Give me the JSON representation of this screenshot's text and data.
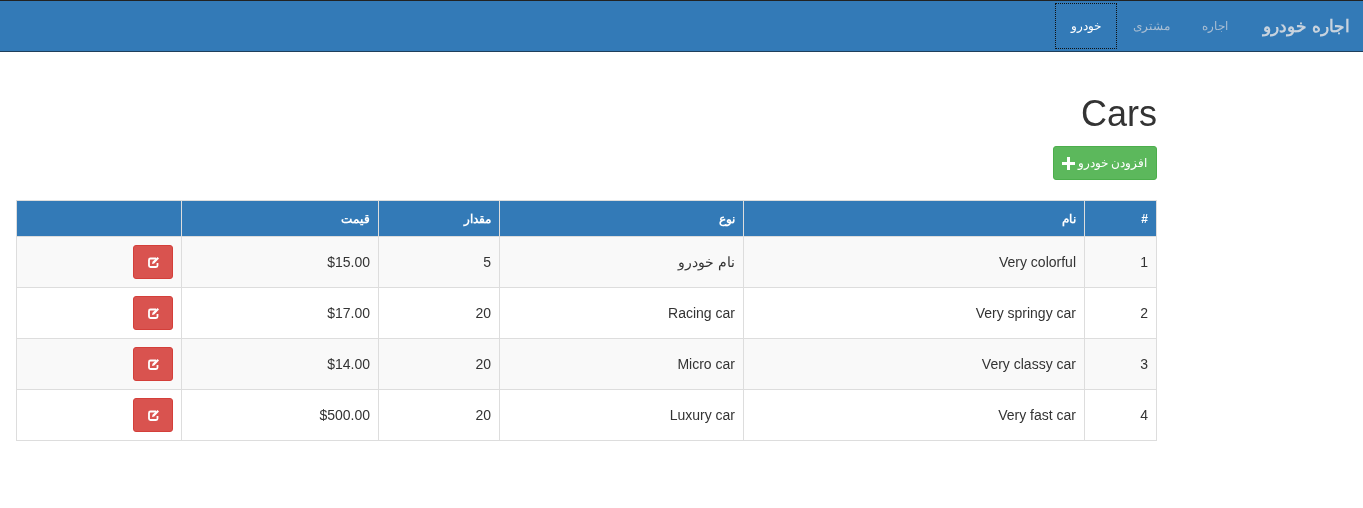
{
  "navbar": {
    "brand": "اجاره خودرو",
    "items": [
      {
        "label": "اجاره",
        "selected": false
      },
      {
        "label": "مشتری",
        "selected": false
      },
      {
        "label": "خودرو",
        "selected": true
      }
    ]
  },
  "page": {
    "title": "Cars",
    "add_button": "افزودن خودرو"
  },
  "table": {
    "columns": [
      "#",
      "نام",
      "نوع",
      "مقدار",
      "قیمت"
    ],
    "rows": [
      {
        "cells": [
          "1",
          "Very colorful",
          "نام خودرو",
          "5",
          "$15.00"
        ]
      },
      {
        "cells": [
          "2",
          "Very springy car",
          "Racing car",
          "20",
          "$17.00"
        ]
      },
      {
        "cells": [
          "3",
          "Very classy car",
          "Micro car",
          "20",
          "$14.00"
        ]
      },
      {
        "cells": [
          "4",
          "Very fast car",
          "Luxury car",
          "20",
          "$500.00"
        ]
      }
    ]
  }
}
